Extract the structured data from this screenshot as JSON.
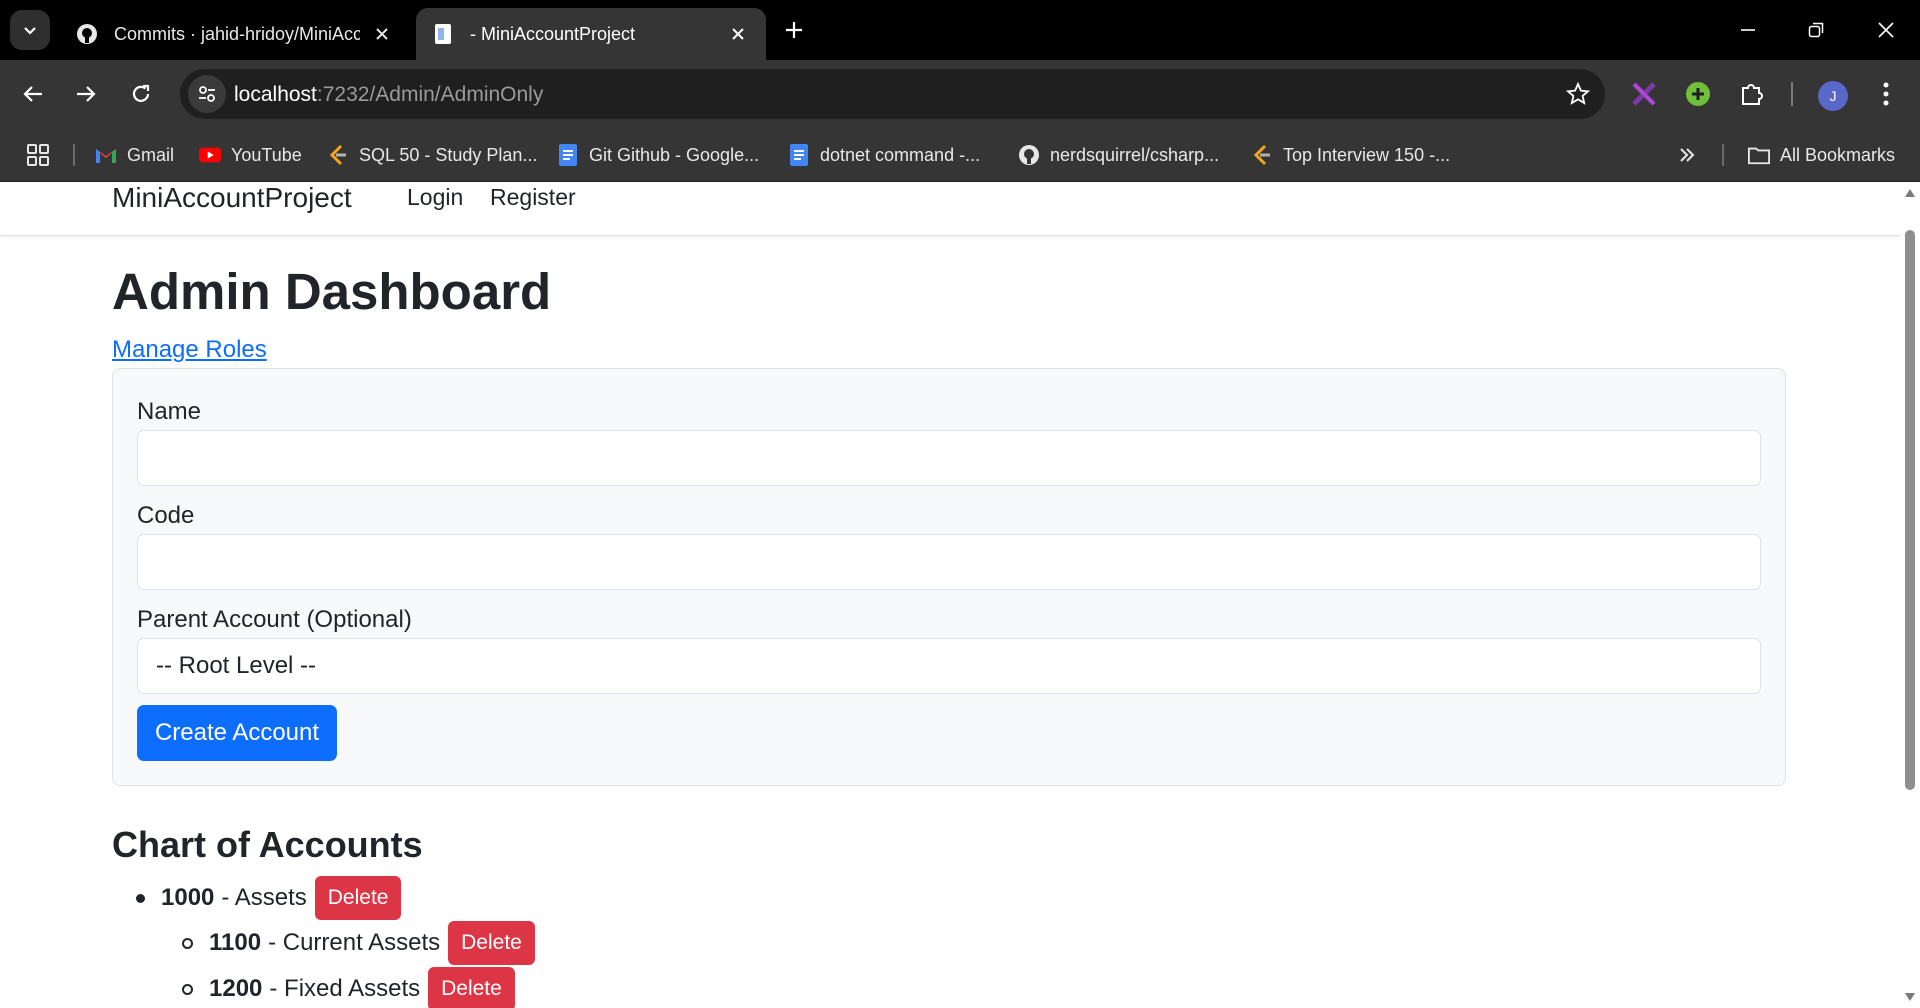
{
  "browser": {
    "tabs": [
      {
        "title": "Commits · jahid-hridoy/MiniAcc",
        "favicon": "github-icon",
        "active": false
      },
      {
        "title": "- MiniAccountProject",
        "favicon": "page-icon",
        "active": true
      }
    ],
    "url_host": "localhost",
    "url_path": ":7232/Admin/AdminOnly",
    "profile_initial": "J",
    "bookmarks": [
      {
        "label": "Gmail",
        "icon": "gmail-icon"
      },
      {
        "label": "YouTube",
        "icon": "youtube-icon"
      },
      {
        "label": "SQL 50 - Study Plan...",
        "icon": "leetcode-icon"
      },
      {
        "label": "Git Github - Google...",
        "icon": "docs-icon"
      },
      {
        "label": "dotnet command -...",
        "icon": "docs-icon"
      },
      {
        "label": "nerdsquirrel/csharp...",
        "icon": "github-icon"
      },
      {
        "label": "Top Interview 150 -...",
        "icon": "leetcode-icon"
      }
    ],
    "all_bookmarks": "All Bookmarks"
  },
  "site": {
    "brand": "MiniAccountProject",
    "nav": {
      "login": "Login",
      "register": "Register"
    }
  },
  "page": {
    "title": "Admin Dashboard",
    "manage_roles": "Manage Roles",
    "form": {
      "name_label": "Name",
      "name_value": "",
      "code_label": "Code",
      "code_value": "",
      "parent_label": "Parent Account (Optional)",
      "parent_selected": "-- Root Level --",
      "submit": "Create Account"
    },
    "chart_heading": "Chart of Accounts",
    "accounts": [
      {
        "code": "1000",
        "name": "- Assets",
        "level": 0,
        "delete": "Delete"
      },
      {
        "code": "1100",
        "name": "- Current Assets",
        "level": 1,
        "delete": "Delete"
      },
      {
        "code": "1200",
        "name": "- Fixed Assets",
        "level": 1,
        "delete": "Delete"
      }
    ]
  },
  "colors": {
    "primary": "#0d6efd",
    "danger": "#dc3545",
    "chrome_dark": "#000000",
    "chrome_toolbar": "#353535"
  }
}
